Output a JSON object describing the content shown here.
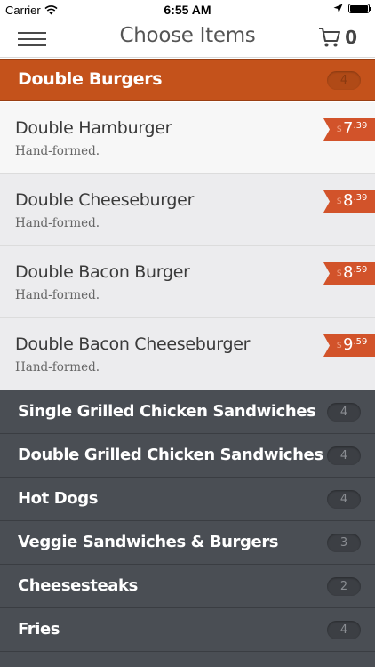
{
  "status_bar": {
    "carrier": "Carrier",
    "time": "6:55 AM"
  },
  "nav": {
    "title": "Choose Items",
    "cart_count": "0"
  },
  "expanded_category": {
    "label": "Double Burgers",
    "count": "4"
  },
  "items": [
    {
      "name": "Double Hamburger",
      "description": "Hand-formed.",
      "currency": "$",
      "price_whole": "7",
      "price_cents": ".39"
    },
    {
      "name": "Double Cheeseburger",
      "description": "Hand-formed.",
      "currency": "$",
      "price_whole": "8",
      "price_cents": ".39"
    },
    {
      "name": "Double Bacon Burger",
      "description": "Hand-formed.",
      "currency": "$",
      "price_whole": "8",
      "price_cents": ".59"
    },
    {
      "name": "Double Bacon Cheeseburger",
      "description": "Hand-formed.",
      "currency": "$",
      "price_whole": "9",
      "price_cents": ".59"
    }
  ],
  "categories": [
    {
      "label": "Single Grilled Chicken Sandwiches",
      "count": "4"
    },
    {
      "label": "Double Grilled Chicken Sandwiches",
      "count": "4"
    },
    {
      "label": "Hot Dogs",
      "count": "4"
    },
    {
      "label": "Veggie Sandwiches & Burgers",
      "count": "3"
    },
    {
      "label": "Cheesesteaks",
      "count": "2"
    },
    {
      "label": "Fries",
      "count": "4"
    }
  ],
  "colors": {
    "accent": "#c4521b",
    "price_tag": "#d2532a",
    "category_bg": "#4a4e54"
  },
  "icons": [
    "wifi-icon",
    "location-arrow-icon",
    "battery-icon",
    "menu-icon",
    "cart-icon"
  ]
}
